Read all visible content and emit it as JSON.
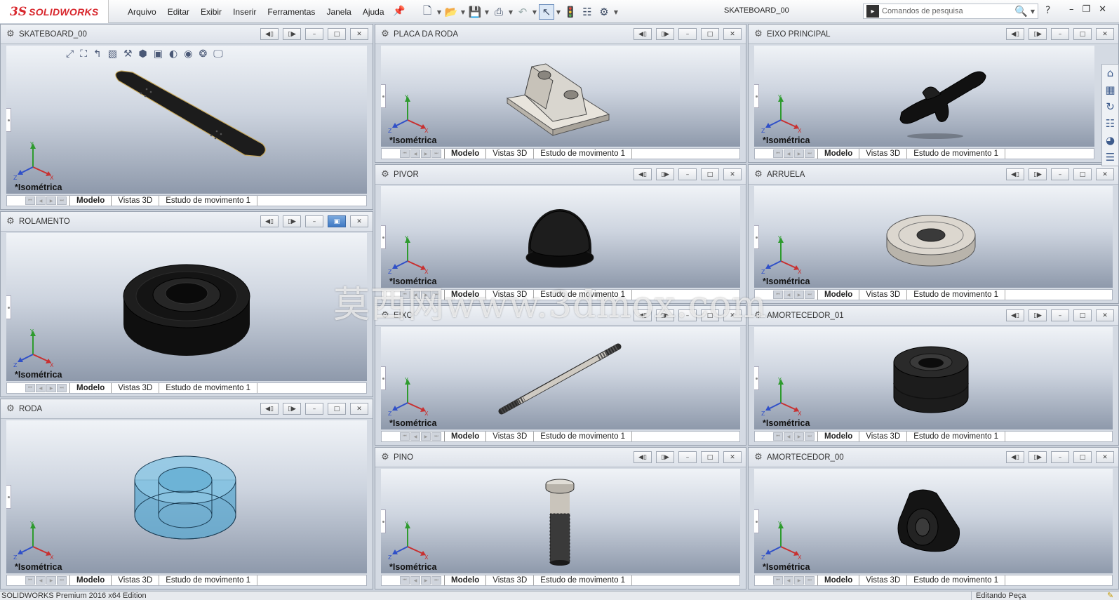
{
  "app": {
    "logo_ds": "3S",
    "logo_text": "SOLIDWORKS",
    "document_title": "SKATEBOARD_00"
  },
  "menu": {
    "items": [
      "Arquivo",
      "Editar",
      "Exibir",
      "Inserir",
      "Ferramentas",
      "Janela",
      "Ajuda"
    ]
  },
  "search": {
    "placeholder": "Comandos de pesquisa"
  },
  "help_label": "?",
  "panes": [
    {
      "title": "SKATEBOARD_00",
      "view": "*Isométrica",
      "active": false
    },
    {
      "title": "PLACA DA RODA",
      "view": "*Isométrica",
      "active": false
    },
    {
      "title": "EIXO PRINCIPAL",
      "view": "*Isométrica",
      "active": false
    },
    {
      "title": "ROLAMENTO",
      "view": "*Isométrica",
      "active": true
    },
    {
      "title": "PIVOR",
      "view": "*Isométrica",
      "active": false
    },
    {
      "title": "ARRUELA",
      "view": "*Isométrica",
      "active": false
    },
    {
      "title": "RODA",
      "view": "*Isométrica",
      "active": false
    },
    {
      "title": "EIXO",
      "view": "*Isométrica",
      "active": false
    },
    {
      "title": "AMORTECEDOR_01",
      "view": "*Isométrica",
      "active": false
    },
    {
      "title": "PINO",
      "view": "*Isométrica",
      "active": false
    },
    {
      "title": "AMORTECEDOR_00",
      "view": "*Isométrica",
      "active": false
    }
  ],
  "tabs": [
    "Modelo",
    "Vistas 3D",
    "Estudo de movimento 1"
  ],
  "triad": {
    "x": "X",
    "y": "Y",
    "z": "Z"
  },
  "status": {
    "left": "SOLIDWORKS Premium 2016 x64 Edition",
    "right": "Editando Peça"
  },
  "watermark": "莫西网www.3dmox.com",
  "colors": {
    "brand_red": "#d8262c",
    "active_button": "#3f79c4",
    "model_dark": "#1c1c1c",
    "model_light": "#d9d6cf",
    "wheel_blue": "#5aa7cf"
  }
}
